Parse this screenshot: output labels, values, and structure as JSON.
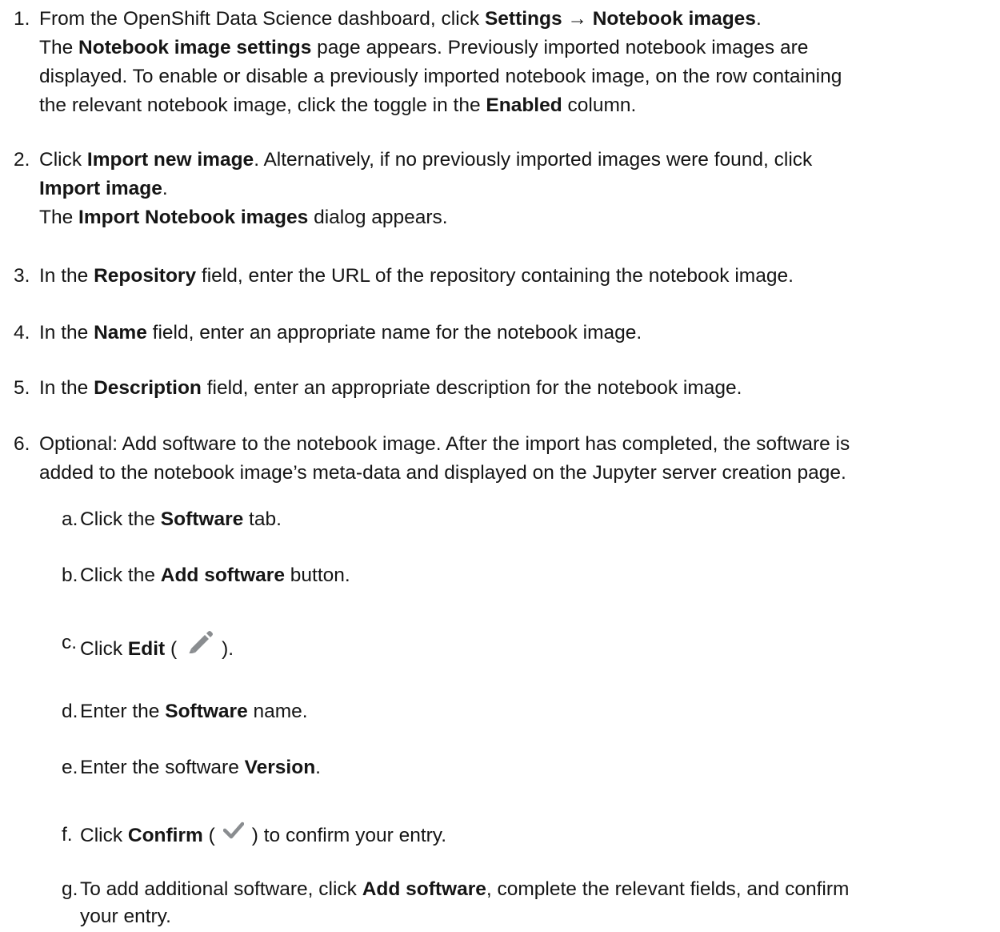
{
  "steps": [
    {
      "n": "1.",
      "lines": [
        [
          "From the OpenShift Data Science dashboard, click ",
          {
            "b": "Settings → Notebook images"
          },
          "."
        ],
        [
          "The ",
          {
            "b": "Notebook image settings"
          },
          " page appears. Previously imported notebook images are"
        ],
        [
          "displayed. To enable or disable a previously imported notebook image, on the row containing"
        ],
        [
          "the relevant notebook image, click the toggle in the ",
          {
            "b": "Enabled"
          },
          " column."
        ]
      ]
    },
    {
      "n": "2.",
      "lines": [
        [
          "Click ",
          {
            "b": "Import new image"
          },
          ". Alternatively, if no previously imported images were found, click"
        ],
        [
          {
            "b": "Import image"
          },
          "."
        ],
        [
          "The ",
          {
            "b": "Import Notebook images"
          },
          " dialog appears."
        ]
      ]
    },
    {
      "n": "3.",
      "lines": [
        [
          "In the ",
          {
            "b": "Repository"
          },
          " field, enter the URL of the repository containing the notebook image."
        ]
      ]
    },
    {
      "n": "4.",
      "lines": [
        [
          "In the ",
          {
            "b": "Name"
          },
          " field, enter an appropriate name for the notebook image."
        ]
      ]
    },
    {
      "n": "5.",
      "lines": [
        [
          "In the ",
          {
            "b": "Description"
          },
          " field, enter an appropriate description for the notebook image."
        ]
      ]
    },
    {
      "n": "6.",
      "lines": [
        [
          "Optional: Add software to the notebook image. After the import has completed, the software is"
        ],
        [
          "added to the notebook image’s meta-data and displayed on the Jupyter server creation page."
        ]
      ],
      "substeps": [
        {
          "n": "a.",
          "lines": [
            [
              "Click the ",
              {
                "b": "Software"
              },
              " tab."
            ]
          ]
        },
        {
          "n": "b.",
          "lines": [
            [
              "Click the ",
              {
                "b": "Add software"
              },
              " button."
            ]
          ]
        },
        {
          "n": "c.",
          "lines": [
            [
              "Click ",
              {
                "b": "Edit"
              },
              " (",
              {
                "icon": "pencil-icon"
              },
              ")."
            ]
          ]
        },
        {
          "n": "d.",
          "lines": [
            [
              "Enter the ",
              {
                "b": "Software"
              },
              " name."
            ]
          ]
        },
        {
          "n": "e.",
          "lines": [
            [
              "Enter the software ",
              {
                "b": "Version"
              },
              "."
            ]
          ]
        },
        {
          "n": "f.",
          "lines": [
            [
              "Click ",
              {
                "b": "Confirm"
              },
              " (",
              {
                "icon": "checkmark-icon"
              },
              ") to confirm your entry."
            ]
          ]
        },
        {
          "n": "g.",
          "lines": [
            [
              "To add additional software, click ",
              {
                "b": "Add software"
              },
              ", complete the relevant fields, and confirm"
            ],
            [
              "your entry."
            ]
          ]
        }
      ]
    }
  ],
  "icon_colors": {
    "pencil-icon": "#8a8d90",
    "checkmark-icon": "#8a8d90"
  }
}
